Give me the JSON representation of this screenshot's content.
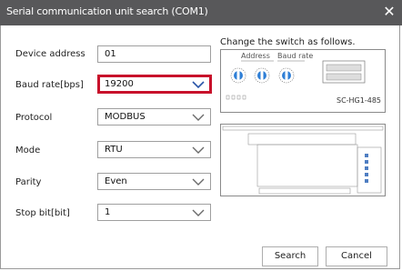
{
  "window": {
    "title": "Serial communication unit search (COM1)",
    "close_glyph": "✕"
  },
  "form": {
    "device_address": {
      "label": "Device address",
      "value": "01"
    },
    "baud_rate": {
      "label": "Baud rate[bps]",
      "value": "19200",
      "highlight_color": "#c8112b",
      "chevron_color": "#2a55a8"
    },
    "protocol": {
      "label": "Protocol",
      "value": "MODBUS"
    },
    "mode": {
      "label": "Mode",
      "value": "RTU"
    },
    "parity": {
      "label": "Parity",
      "value": "Even"
    },
    "stop_bit": {
      "label": "Stop bit[bit]",
      "value": "1"
    }
  },
  "illustration": {
    "hint": "Change the switch as follows.",
    "address_label": "Address",
    "baud_label": "Baud rate",
    "model": "SC-HG1-485"
  },
  "buttons": {
    "search": "Search",
    "cancel": "Cancel"
  }
}
